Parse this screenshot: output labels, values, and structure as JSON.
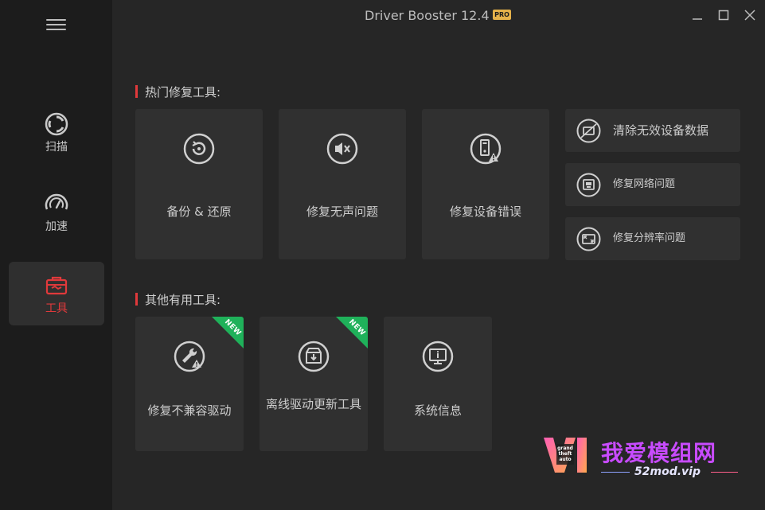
{
  "window": {
    "title": "Driver Booster 12.4",
    "badge": "PRO"
  },
  "sidebar": {
    "items": [
      {
        "label": "扫描",
        "icon": "scan-icon"
      },
      {
        "label": "加速",
        "icon": "speedometer-icon"
      },
      {
        "label": "工具",
        "icon": "toolbox-icon",
        "active": true
      }
    ]
  },
  "sections": {
    "hot": {
      "title": "热门修复工具:"
    },
    "other": {
      "title": "其他有用工具:"
    }
  },
  "hot_tools": [
    {
      "label": "备份 & 还原",
      "icon": "backup-restore-icon"
    },
    {
      "label": "修复无声问题",
      "icon": "no-sound-icon"
    },
    {
      "label": "修复设备错误",
      "icon": "device-error-icon"
    }
  ],
  "side_tools": [
    {
      "label": "清除无效设备数据",
      "icon": "clean-device-data-icon"
    },
    {
      "label": "修复网络问题",
      "icon": "network-port-icon"
    },
    {
      "label": "修复分辨率问题",
      "icon": "resolution-icon"
    }
  ],
  "other_tools": [
    {
      "label": "修复不兼容驱动",
      "icon": "wrench-warning-icon",
      "new": "NEW"
    },
    {
      "label": "离线驱动更新工具",
      "icon": "offline-update-icon",
      "new": "NEW"
    },
    {
      "label": "系统信息",
      "icon": "system-info-icon"
    }
  ],
  "watermark": {
    "brand": "我爱模组网",
    "url": "52mod.vip"
  },
  "colors": {
    "accent": "#e0393b",
    "pro": "#e6b24a",
    "new_ribbon": "#1fb15a",
    "background": "#262626",
    "sidebar": "#1c1c1c",
    "card": "#303030"
  }
}
